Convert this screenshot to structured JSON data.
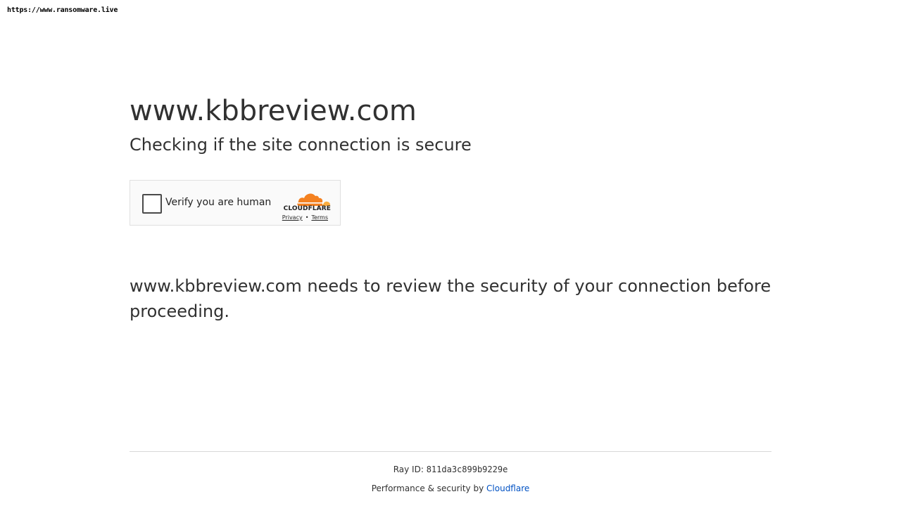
{
  "watermark": "https://www.ransomware.live",
  "site": {
    "title": "www.kbbreview.com",
    "subtitle": "Checking if the site connection is secure"
  },
  "challenge": {
    "checkbox_label": "Verify you are human",
    "brand": "CLOUDFLARE",
    "privacy_link": "Privacy",
    "separator": "•",
    "terms_link": "Terms",
    "logo_icon": "cloudflare-cloud-icon",
    "logo_colors": {
      "primary": "#f48120",
      "secondary": "#faad3f"
    }
  },
  "description": "www.kbbreview.com needs to review the security of your connection before proceeding.",
  "footer": {
    "ray_label": "Ray ID:",
    "ray_id": "811da3c899b9229e",
    "perf_text": "Performance & security by",
    "perf_link": "Cloudflare",
    "link_color": "#0051c3"
  }
}
